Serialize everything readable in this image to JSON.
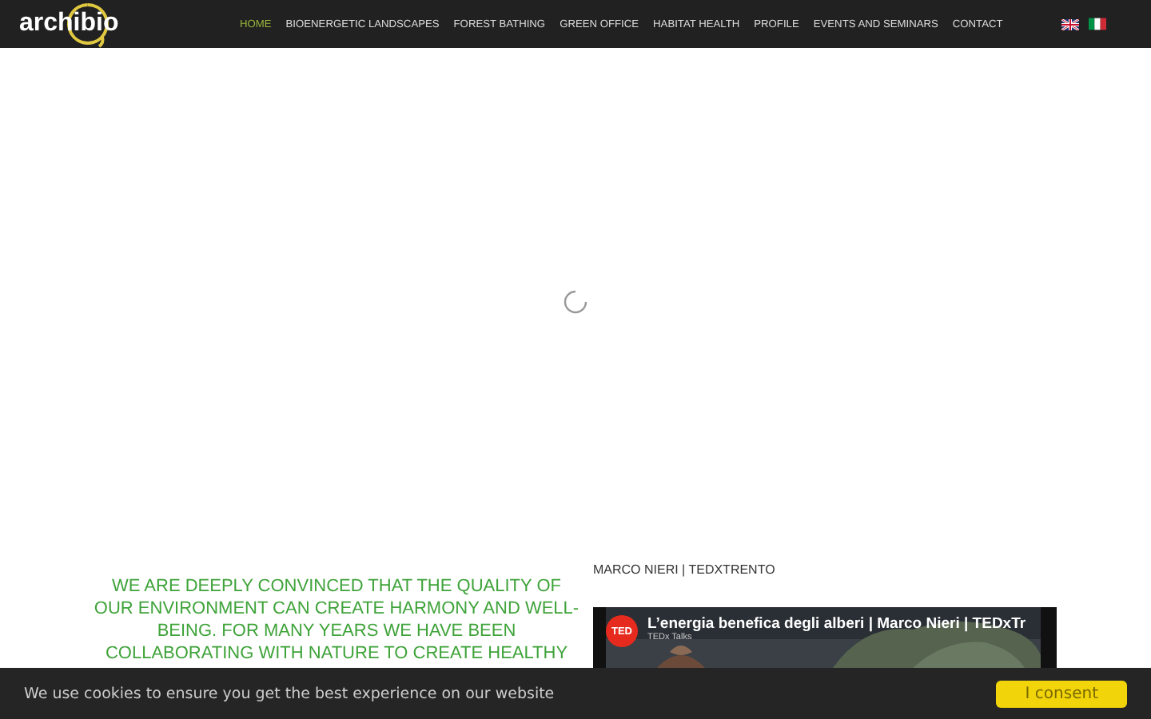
{
  "header": {
    "logo": "archibio",
    "nav": [
      {
        "label": "HOME",
        "selected": true
      },
      {
        "label": "BIOENERGETIC LANDSCAPES",
        "selected": false
      },
      {
        "label": "FOREST BATHING",
        "selected": false
      },
      {
        "label": "GREEN OFFICE",
        "selected": false
      },
      {
        "label": "HABITAT HEALTH",
        "selected": false
      },
      {
        "label": "PROFILE",
        "selected": false
      },
      {
        "label": "EVENTS AND SEMINARS",
        "selected": false
      },
      {
        "label": "CONTACT",
        "selected": false
      }
    ],
    "languages": [
      {
        "kind": "uk"
      },
      {
        "kind": "it"
      }
    ]
  },
  "intro": "WE ARE DEEPLY CONVINCED THAT THE QUALITY OF OUR ENVIRONMENT CAN CREATE HARMONY AND WELL-BEING. FOR MANY YEARS WE HAVE BEEN COLLABORATING WITH NATURE TO CREATE HEALTHY",
  "video": {
    "heading": "MARCO NIERI | TEDXTRENTO",
    "badge": "TED",
    "title": "L’energia benefica degli alberi | Marco Nieri | TEDxTr",
    "channel": "TEDx Talks"
  },
  "cookie_bar": {
    "message": "We use cookies to ensure you get the best experience on our website",
    "button": "I consent"
  }
}
